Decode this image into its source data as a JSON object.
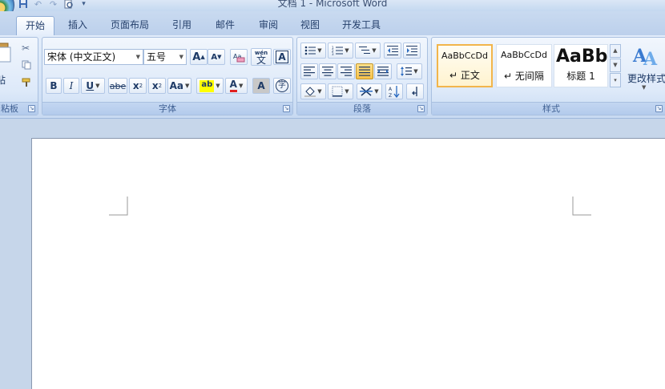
{
  "window": {
    "title": "文档 1 - Microsoft Word"
  },
  "tabs": [
    {
      "label": "开始",
      "active": true
    },
    {
      "label": "插入"
    },
    {
      "label": "页面布局"
    },
    {
      "label": "引用"
    },
    {
      "label": "邮件"
    },
    {
      "label": "审阅"
    },
    {
      "label": "视图"
    },
    {
      "label": "开发工具"
    }
  ],
  "clipboard": {
    "paste_label": "贴",
    "group_label": "粘板"
  },
  "font": {
    "group_label": "字体",
    "font_name": "宋体 (中文正文)",
    "font_size": "五号",
    "grow_glyph": "A",
    "shrink_glyph": "A",
    "phonetic_glyph": "wén",
    "phonetic_char": "文",
    "border_glyph": "A",
    "bold": "B",
    "italic": "I",
    "underline": "U",
    "strike": "abe",
    "subscript": "x",
    "superscript": "x",
    "change_case": "Aa",
    "highlight": "ab",
    "font_color": "A",
    "shading_glyph": "A",
    "enclose_glyph": "字",
    "font_color_hex": "#e02020",
    "highlight_hex": "#ffff00"
  },
  "paragraph": {
    "group_label": "段落"
  },
  "styles": {
    "group_label": "样式",
    "items": [
      {
        "sample": "AaBbCcDd",
        "name": "正文",
        "selected": true
      },
      {
        "sample": "AaBbCcDd",
        "name": "无间隔"
      },
      {
        "sample": "AaBb",
        "name": "标题 1"
      }
    ],
    "change_styles": "更改样式"
  }
}
